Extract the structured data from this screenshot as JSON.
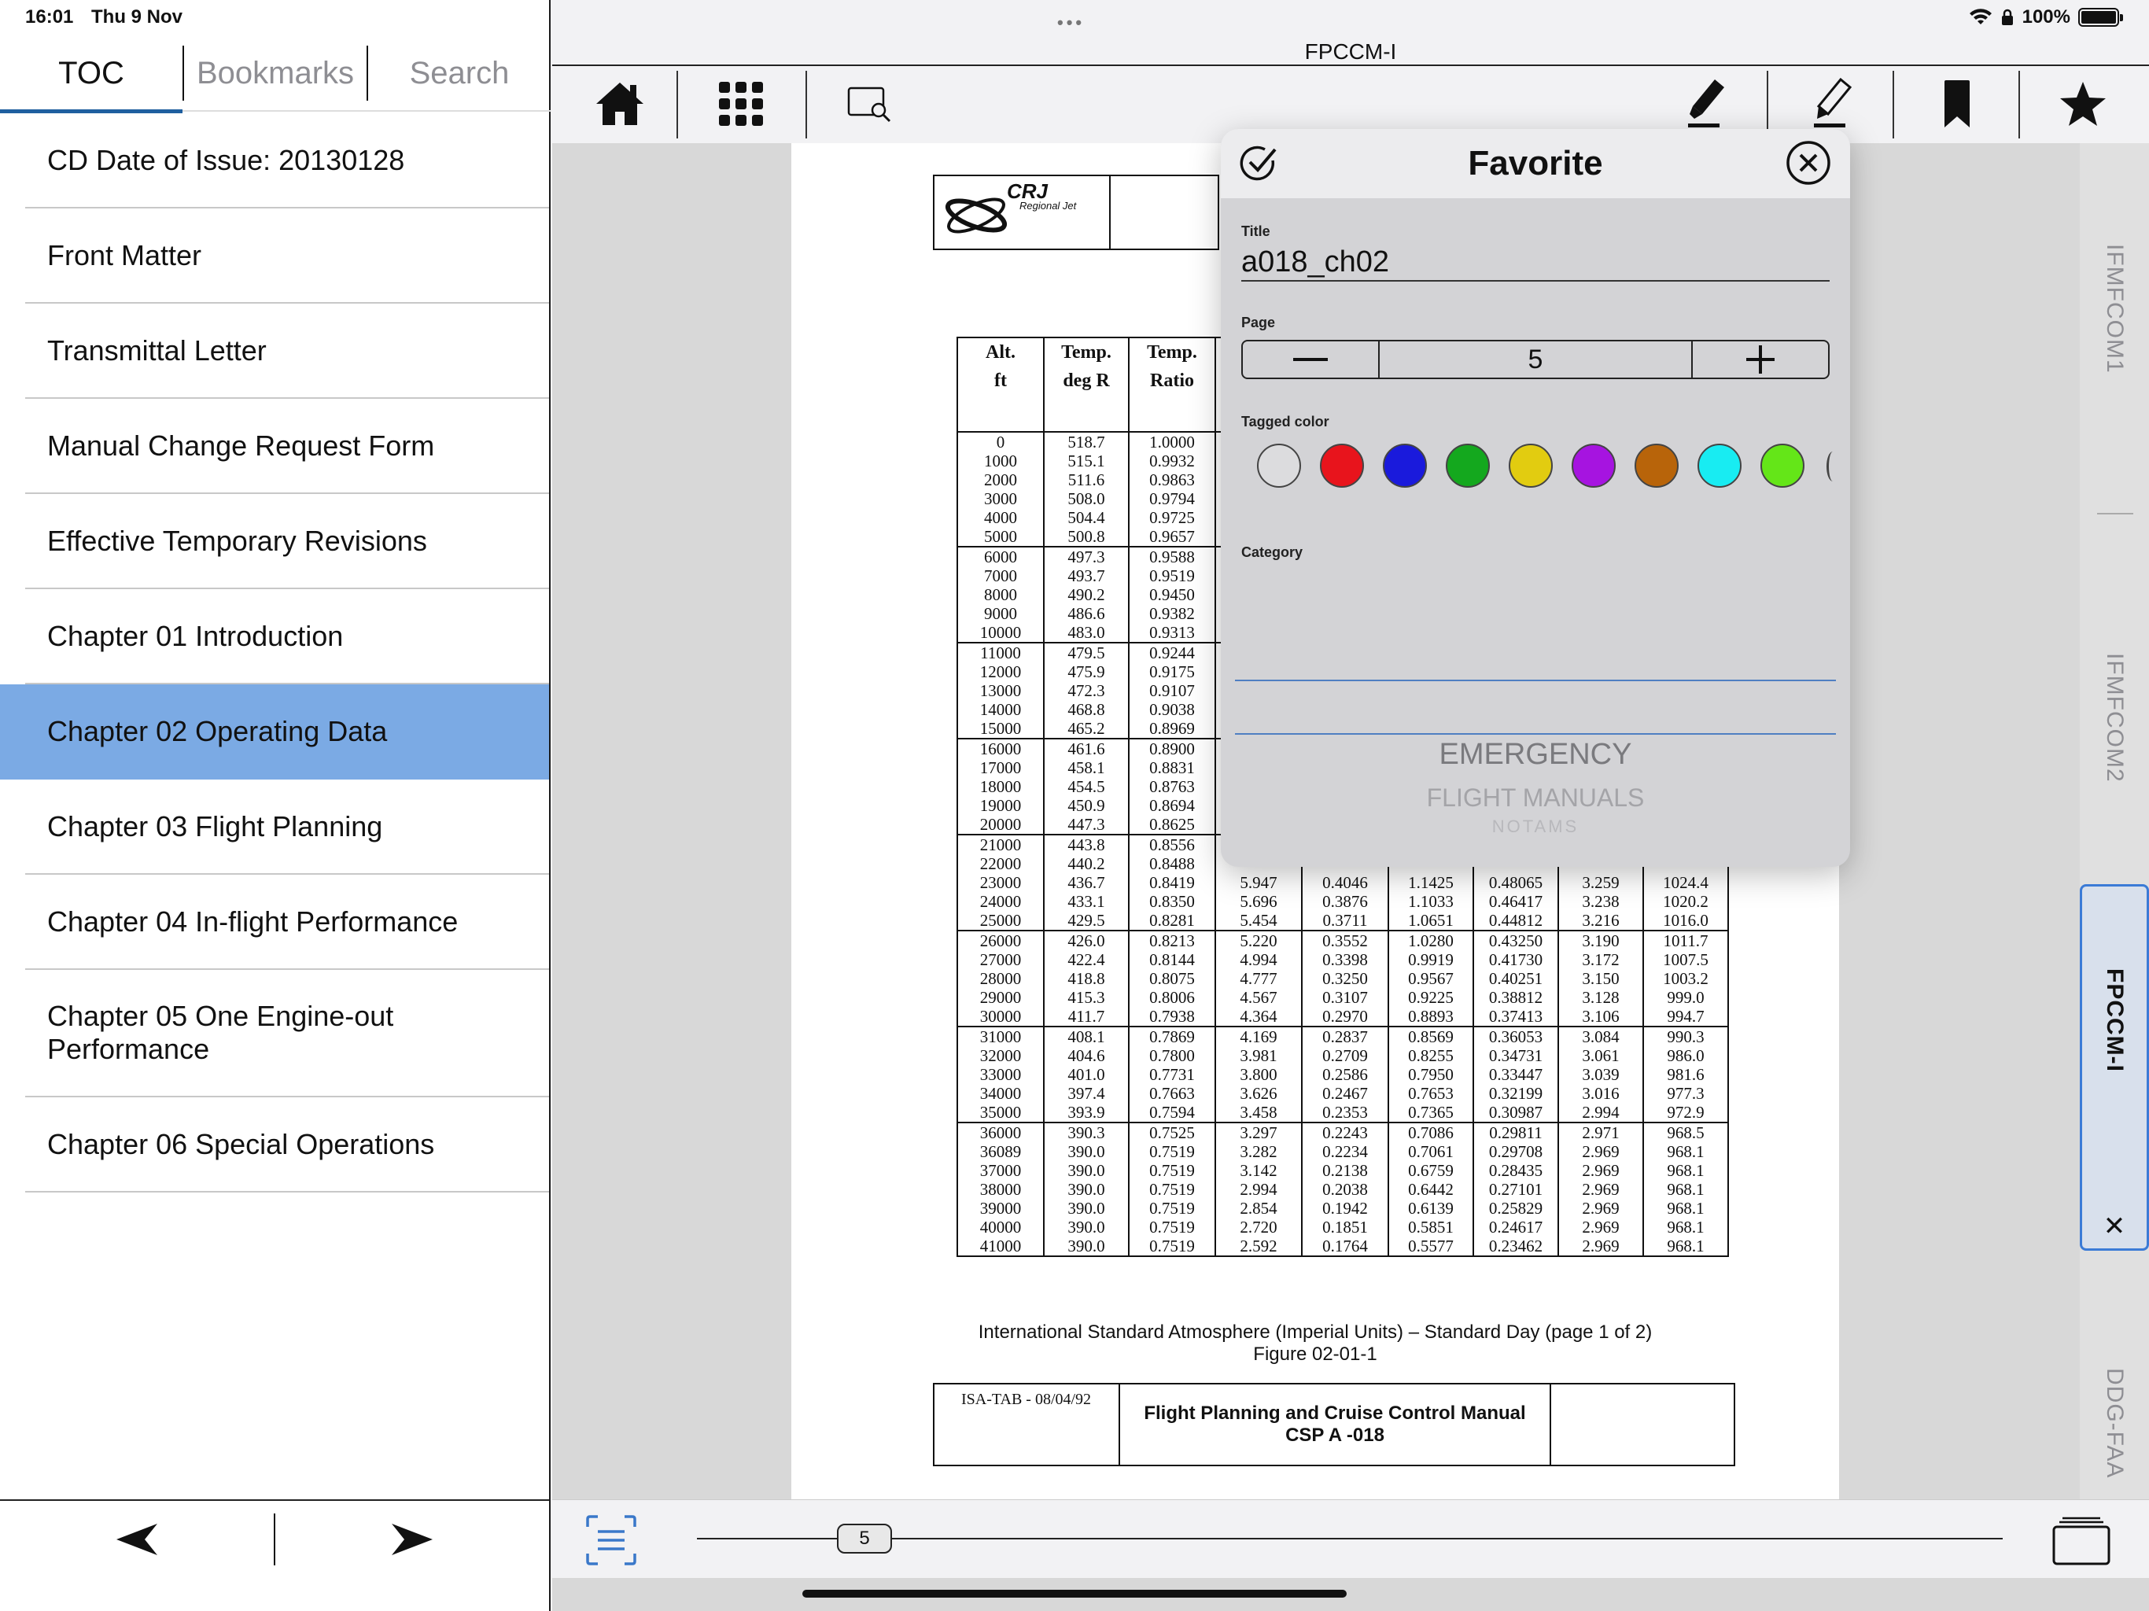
{
  "status": {
    "time": "16:01",
    "date": "Thu 9 Nov",
    "battery": "100%"
  },
  "left_panel": {
    "tabs": [
      "TOC",
      "Bookmarks",
      "Search"
    ],
    "toc": [
      "CD Date of Issue: 20130128",
      "Front Matter",
      "Transmittal Letter",
      "Manual Change Request Form",
      "Effective Temporary Revisions",
      "Chapter 01 Introduction",
      "Chapter 02 Operating Data",
      "Chapter 03 Flight Planning",
      "Chapter 04 In-flight Performance",
      "Chapter 05 One Engine-out Performance",
      "Chapter 06 Special Operations"
    ],
    "selected_index": 6
  },
  "window": {
    "title": "FPCCM-I"
  },
  "right_tabs": [
    "IFMFCOM1",
    "IFMFCOM2",
    "FPCCM-I",
    "DDG-FAA"
  ],
  "page": {
    "logo_text": "CRJ",
    "logo_subtext": "Regional Jet",
    "table_headers": [
      [
        "Alt.",
        "ft"
      ],
      [
        "Temp.",
        "deg R"
      ],
      [
        "Temp.",
        "Ratio"
      ]
    ],
    "alt": [
      "0",
      "1000",
      "2000",
      "3000",
      "4000",
      "5000",
      "6000",
      "7000",
      "8000",
      "9000",
      "10000",
      "11000",
      "12000",
      "13000",
      "14000",
      "15000",
      "16000",
      "17000",
      "18000",
      "19000",
      "20000",
      "21000",
      "22000",
      "23000",
      "24000",
      "25000",
      "26000",
      "27000",
      "28000",
      "29000",
      "30000",
      "31000",
      "32000",
      "33000",
      "34000",
      "35000",
      "36000",
      "36089",
      "37000",
      "38000",
      "39000",
      "40000",
      "41000"
    ],
    "temp_r": [
      "518.7",
      "515.1",
      "511.6",
      "508.0",
      "504.4",
      "500.8",
      "497.3",
      "493.7",
      "490.2",
      "486.6",
      "483.0",
      "479.5",
      "475.9",
      "472.3",
      "468.8",
      "465.2",
      "461.6",
      "458.1",
      "454.5",
      "450.9",
      "447.3",
      "443.8",
      "440.2",
      "436.7",
      "433.1",
      "429.5",
      "426.0",
      "422.4",
      "418.8",
      "415.3",
      "411.7",
      "408.1",
      "404.6",
      "401.0",
      "397.4",
      "393.9",
      "390.3",
      "390.0",
      "390.0",
      "390.0",
      "390.0",
      "390.0",
      "390.0"
    ],
    "temp_ratio": [
      "1.0000",
      "0.9932",
      "0.9863",
      "0.9794",
      "0.9725",
      "0.9657",
      "0.9588",
      "0.9519",
      "0.9450",
      "0.9382",
      "0.9313",
      "0.9244",
      "0.9175",
      "0.9107",
      "0.9038",
      "0.8969",
      "0.8900",
      "0.8831",
      "0.8763",
      "0.8694",
      "0.8625",
      "0.8556",
      "0.8488",
      "0.8419",
      "0.8350",
      "0.8281",
      "0.8213",
      "0.8144",
      "0.8075",
      "0.8006",
      "0.7938",
      "0.7869",
      "0.7800",
      "0.7731",
      "0.7663",
      "0.7594",
      "0.7525",
      "0.7519",
      "0.7519",
      "0.7519",
      "0.7519",
      "0.7519",
      "0.7519"
    ],
    "extra_cols": [
      [
        "5.947",
        "0.4046",
        "1.1425",
        "0.48065",
        "3.259",
        "1024.4"
      ],
      [
        "5.696",
        "0.3876",
        "1.1033",
        "0.46417",
        "3.238",
        "1020.2"
      ],
      [
        "5.454",
        "0.3711",
        "1.0651",
        "0.44812",
        "3.216",
        "1016.0"
      ],
      [
        "5.220",
        "0.3552",
        "1.0280",
        "0.43250",
        "3.190",
        "1011.7"
      ],
      [
        "4.994",
        "0.3398",
        "0.9919",
        "0.41730",
        "3.172",
        "1007.5"
      ],
      [
        "4.777",
        "0.3250",
        "0.9567",
        "0.40251",
        "3.150",
        "1003.2"
      ],
      [
        "4.567",
        "0.3107",
        "0.9225",
        "0.38812",
        "3.128",
        "999.0"
      ],
      [
        "4.364",
        "0.2970",
        "0.8893",
        "0.37413",
        "3.106",
        "994.7"
      ],
      [
        "4.169",
        "0.2837",
        "0.8569",
        "0.36053",
        "3.084",
        "990.3"
      ],
      [
        "3.981",
        "0.2709",
        "0.8255",
        "0.34731",
        "3.061",
        "986.0"
      ],
      [
        "3.800",
        "0.2586",
        "0.7950",
        "0.33447",
        "3.039",
        "981.6"
      ],
      [
        "3.626",
        "0.2467",
        "0.7653",
        "0.32199",
        "3.016",
        "977.3"
      ],
      [
        "3.458",
        "0.2353",
        "0.7365",
        "0.30987",
        "2.994",
        "972.9"
      ],
      [
        "3.297",
        "0.2243",
        "0.7086",
        "0.29811",
        "2.971",
        "968.5"
      ],
      [
        "3.282",
        "0.2234",
        "0.7061",
        "0.29708",
        "2.969",
        "968.1"
      ],
      [
        "3.142",
        "0.2138",
        "0.6759",
        "0.28435",
        "2.969",
        "968.1"
      ],
      [
        "2.994",
        "0.2038",
        "0.6442",
        "0.27101",
        "2.969",
        "968.1"
      ],
      [
        "2.854",
        "0.1942",
        "0.6139",
        "0.25829",
        "2.969",
        "968.1"
      ],
      [
        "2.720",
        "0.1851",
        "0.5851",
        "0.24617",
        "2.969",
        "968.1"
      ],
      [
        "2.592",
        "0.1764",
        "0.5577",
        "0.23462",
        "2.969",
        "968.1"
      ]
    ],
    "table_note": "ISA-TAB - 08/04/92",
    "caption_line1": "International Standard Atmosphere (Imperial Units) – Standard Day (page 1 of 2)",
    "caption_line2": "Figure 02-01-1",
    "footer_line1": "Flight Planning and Cruise Control Manual",
    "footer_line2": "CSP A -018"
  },
  "favorite_popover": {
    "title": "Favorite",
    "title_label": "Title",
    "title_value": "a018_ch02",
    "page_label": "Page",
    "page_value": "5",
    "color_label": "Tagged color",
    "colors": [
      "#dcdcde",
      "#e8141c",
      "#1a1adc",
      "#14a81e",
      "#e2cc10",
      "#a614e0",
      "#b8640a",
      "#18ecf2",
      "#64e618"
    ],
    "category_label": "Category",
    "categories": [
      "EMERGENCY",
      "FLIGHT MANUALS",
      "NOTAMS"
    ]
  },
  "bottom": {
    "page_indicator": "5"
  }
}
